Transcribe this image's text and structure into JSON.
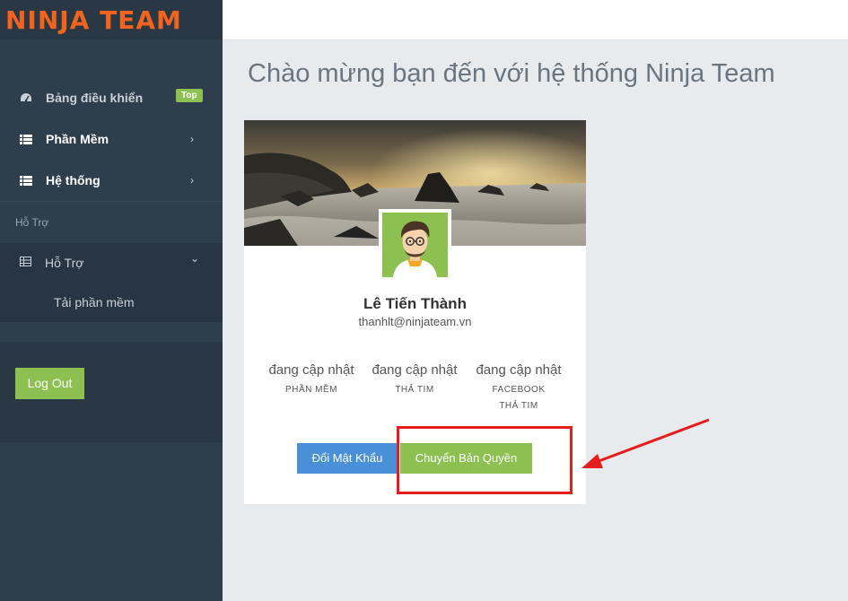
{
  "brand": {
    "logo_text": "NINJA TEAM"
  },
  "sidebar": {
    "items": [
      {
        "label": "Bảng điều khiển",
        "badge": "Top",
        "icon": "dashboard-icon"
      },
      {
        "label": "Phần Mềm",
        "icon": "grid-icon",
        "chevron": "›"
      },
      {
        "label": "Hệ thống",
        "icon": "grid-icon",
        "chevron": "›"
      }
    ],
    "section_label": "Hỗ Trợ",
    "support": {
      "label": "Hỗ Trợ",
      "chevron": "⌄",
      "sub_items": [
        {
          "label": "Tải phần mềm"
        }
      ]
    },
    "logout_label": "Log Out"
  },
  "main": {
    "title": "Chào mừng bạn đến với hệ thống Ninja Team"
  },
  "profile": {
    "name": "Lê Tiến Thành",
    "email": "thanhlt@ninjateam.vn",
    "stats": [
      {
        "value": "đang cập nhật",
        "label": "PHẦN MỀM"
      },
      {
        "value": "đang cập nhật",
        "label": "THẢ TIM"
      },
      {
        "value": "đang cập nhật",
        "label": "FACEBOOK THẢ TIM"
      }
    ],
    "buttons": {
      "change_password": "Đổi Mật Khẩu",
      "transfer_license": "Chuyển Bản Quyền"
    }
  },
  "colors": {
    "accent_orange": "#f0641e",
    "green": "#8cc152",
    "blue": "#4a90d9",
    "highlight_red": "#e51d1d"
  }
}
